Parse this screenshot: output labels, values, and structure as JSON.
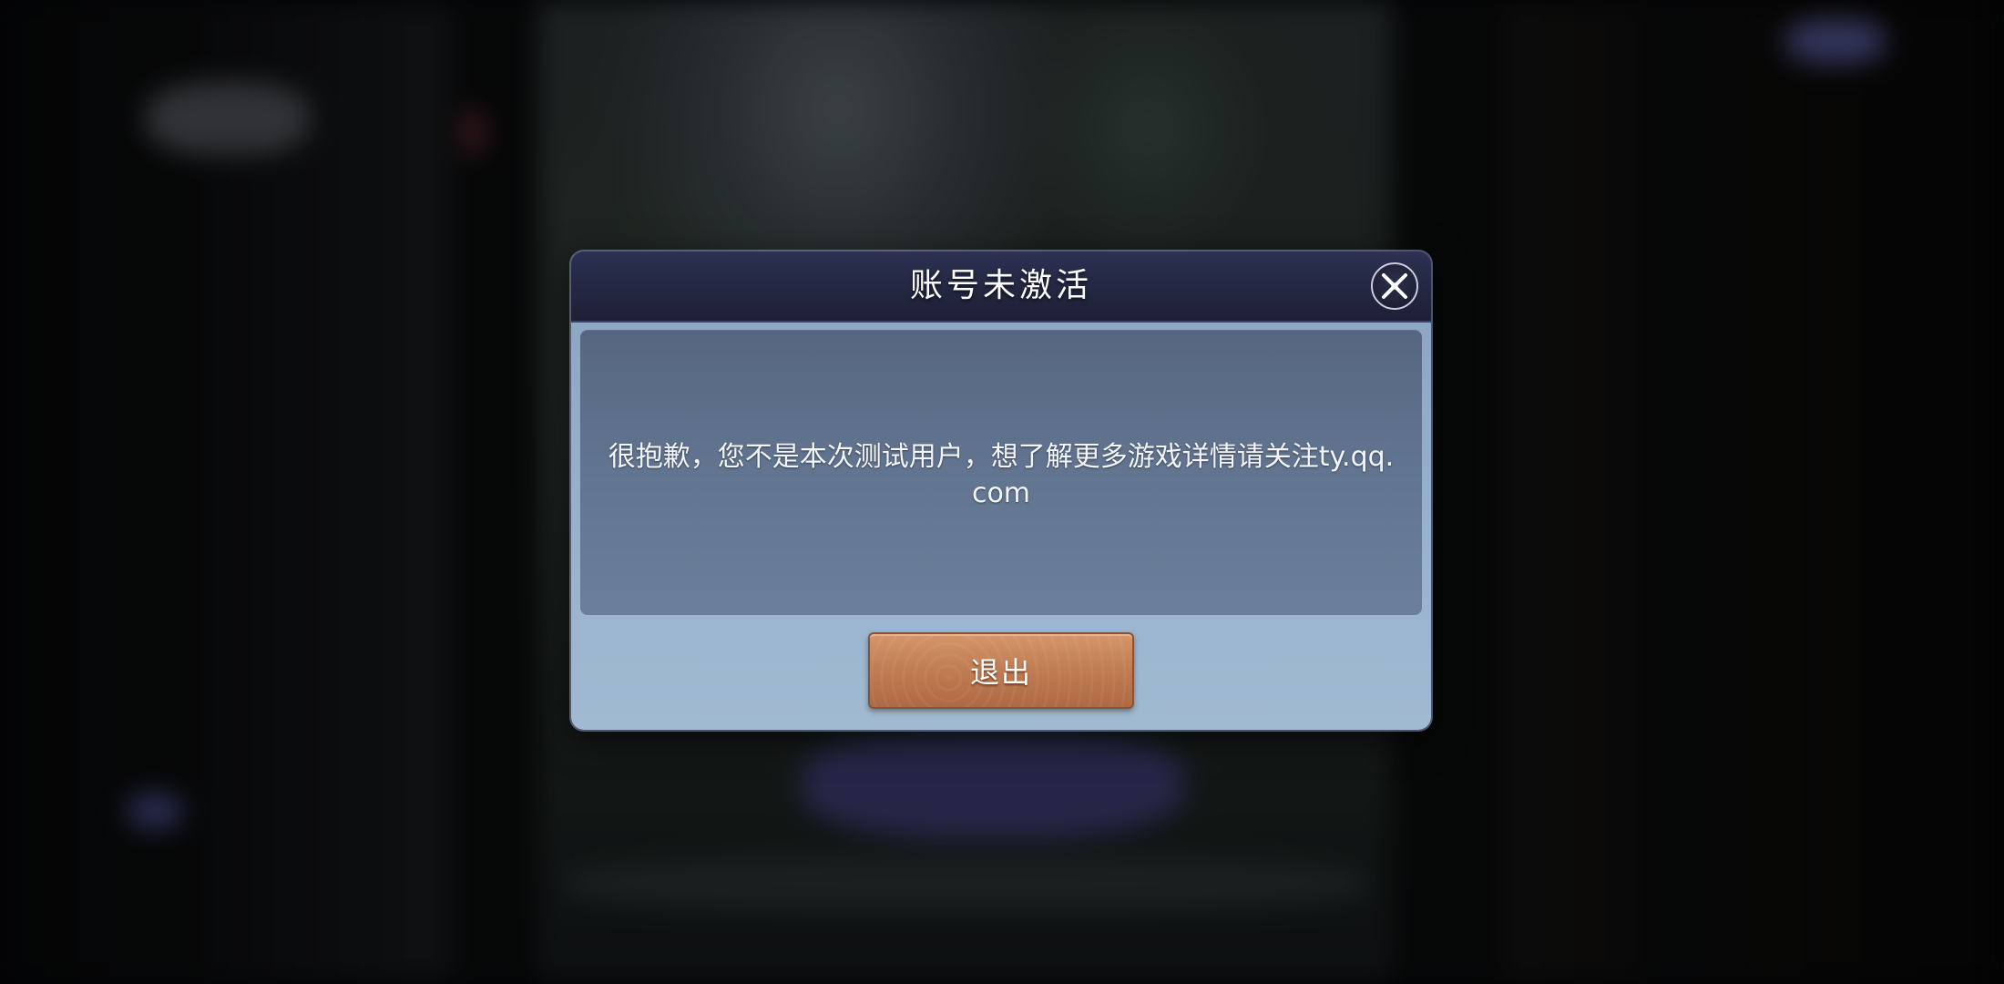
{
  "dialog": {
    "title": "账号未激活",
    "message": "很抱歉，您不是本次测试用户，想了解更多游戏详情请关注ty.qq.com",
    "exit_label": "退出",
    "close_icon": "close-icon"
  },
  "colors": {
    "header_bg": "#22263f",
    "panel_bg": "#627590",
    "dialog_bg": "#97b2cc",
    "button_bg": "#c07c52"
  }
}
